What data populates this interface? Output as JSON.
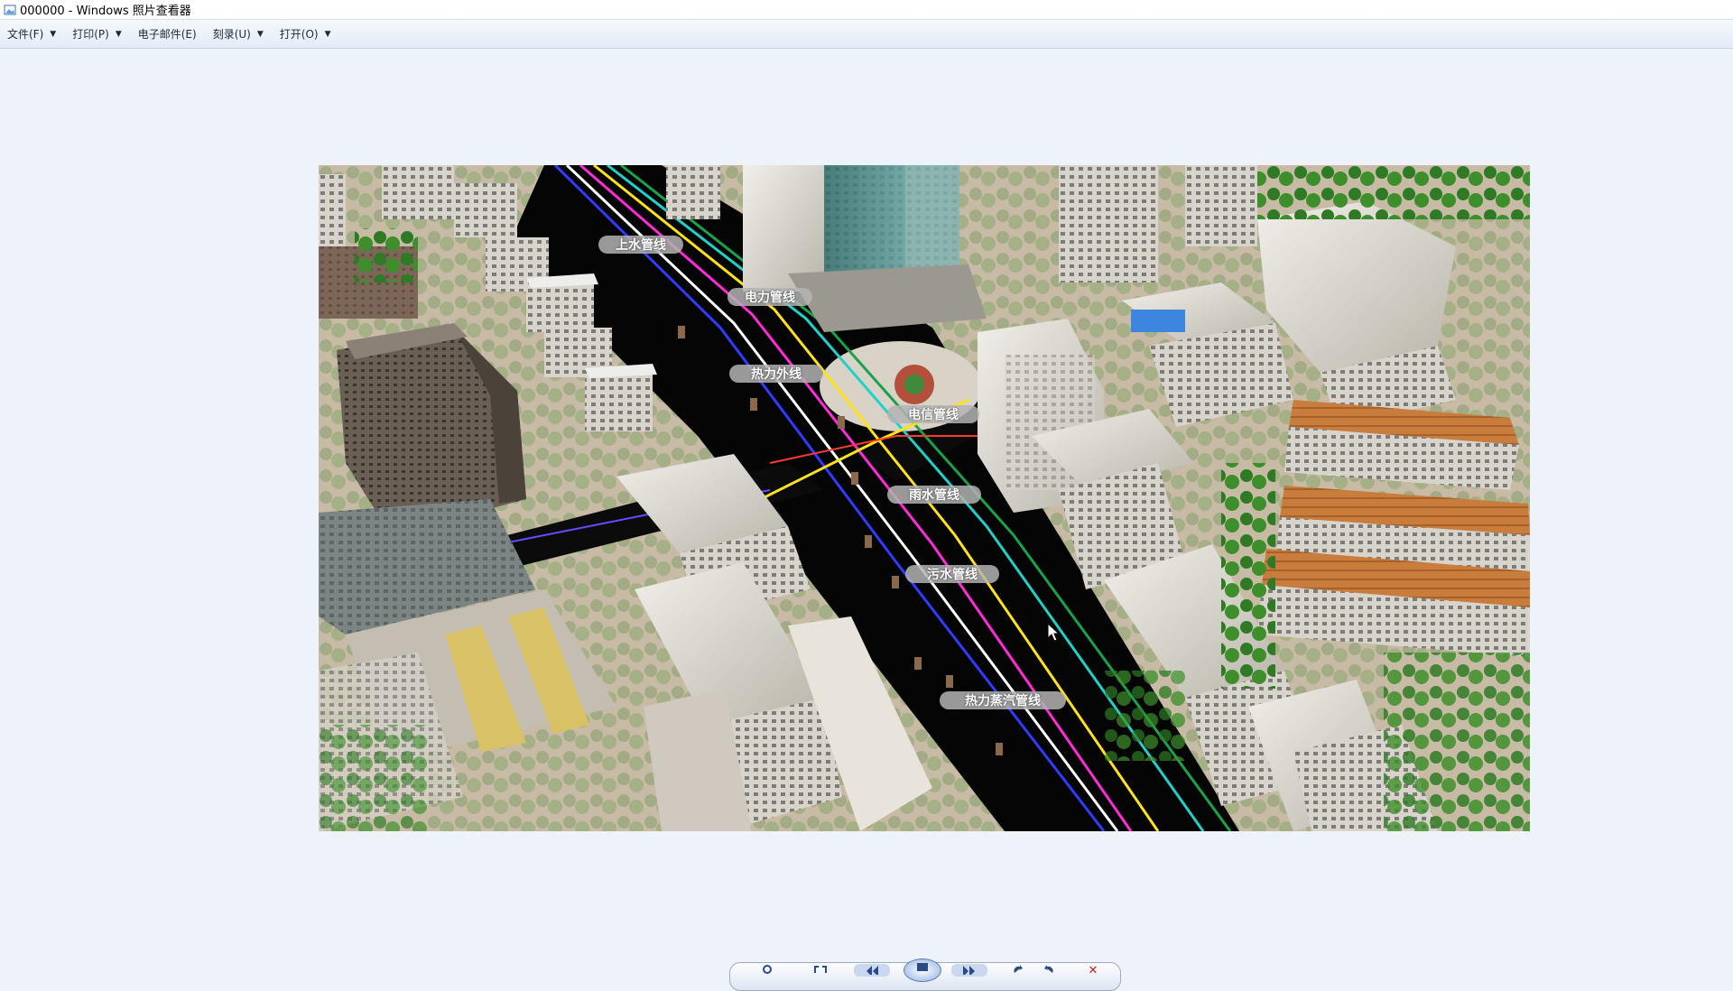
{
  "window": {
    "title": "000000 - Windows 照片查看器"
  },
  "menu": [
    {
      "label": "文件(F)",
      "has_dropdown": true
    },
    {
      "label": "打印(P)",
      "has_dropdown": true
    },
    {
      "label": "电子邮件(E)",
      "has_dropdown": false
    },
    {
      "label": "刻录(U)",
      "has_dropdown": true
    },
    {
      "label": "打开(O)",
      "has_dropdown": true
    }
  ],
  "photo": {
    "pipeline_labels": [
      {
        "text": "上水管线"
      },
      {
        "text": "电力管线"
      },
      {
        "text": "热力外线"
      },
      {
        "text": "电信管线"
      },
      {
        "text": "雨水管线"
      },
      {
        "text": "污水管线"
      },
      {
        "text": "热力蒸汽管线"
      }
    ],
    "pipe_colors": [
      "#2f3cff",
      "#ffffff",
      "#ff2bd6",
      "#ffe21a",
      "#1fd1c8",
      "#ff3b2f",
      "#1aa24a"
    ]
  },
  "toolbar": {
    "buttons": [
      "magnifier-icon",
      "actual-size-icon",
      "previous-icon",
      "slideshow-icon",
      "next-icon",
      "rotate-left-icon",
      "rotate-right-icon",
      "delete-icon"
    ]
  }
}
